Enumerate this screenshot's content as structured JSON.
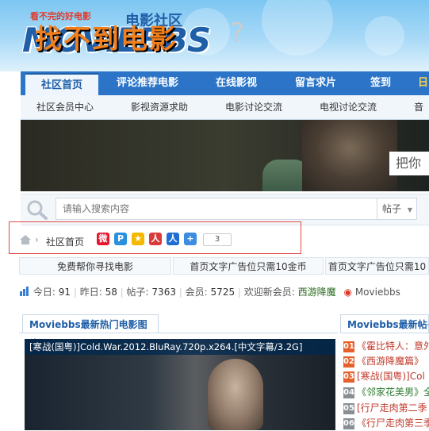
{
  "header": {
    "logo_text": "MOViEBBS",
    "logo_tagline": "看不完的好电影",
    "logo_cn": "电影社区"
  },
  "nav": {
    "items": [
      "社区首页",
      "评论推荐电影",
      "在线影视",
      "留言求片",
      "签到",
      "日"
    ]
  },
  "subnav": {
    "items": [
      "社区会员中心",
      "影视资源求助",
      "电影讨论交流",
      "电视讨论交流",
      "音乐"
    ]
  },
  "banner": {
    "text": "找不到电影",
    "question": "?",
    "side_text": "把你"
  },
  "search": {
    "placeholder": "请输入搜索内容",
    "type": "帖子"
  },
  "breadcrumb": {
    "label": "社区首页",
    "share_count": "3"
  },
  "ads": [
    "免费帮你寻找电影",
    "首页文字广告位只需10金币",
    "首页文字广告位只需10"
  ],
  "stats": {
    "today_label": "今日:",
    "today": "91",
    "yesterday_label": "昨日:",
    "yesterday": "58",
    "posts_label": "帖子:",
    "posts": "7363",
    "members_label": "会员:",
    "members": "5725",
    "welcome_label": "欢迎新会员:",
    "new_member": "西游降魔",
    "weibo": "Moviebbs"
  },
  "left_panel": {
    "title": "Moviebbs最新热门电影图片",
    "caption": "[寒战(国粤)]Cold.War.2012.BluRay.720p.x264.[中文字幕/3.2G]"
  },
  "right_panel": {
    "title": "Moviebbs最新帖子",
    "items": [
      {
        "n": "01",
        "text": "《霍比特人：意外"
      },
      {
        "n": "02",
        "text": "《西游降魔篇》"
      },
      {
        "n": "03",
        "text": "[寒战(国粤)]Col"
      },
      {
        "n": "04",
        "text": "《邻家花美男》全"
      },
      {
        "n": "05",
        "text": "[行尸走肉第二季"
      },
      {
        "n": "06",
        "text": "《行尸走肉第三季"
      }
    ]
  },
  "colors": {
    "nav_blue": "#2b74c7",
    "link_blue": "#1f5fa8",
    "banner_orange": "#f07f1c",
    "highlight_red": "#e04848"
  }
}
